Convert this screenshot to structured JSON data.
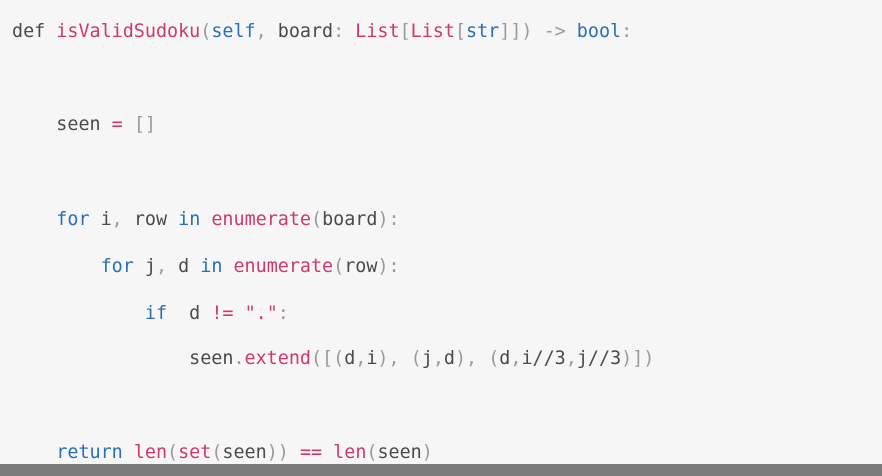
{
  "code": {
    "lines": [
      {
        "id": "line-def",
        "tokens": [
          {
            "t": "def",
            "c": "plain"
          },
          {
            "t": " ",
            "c": "plain"
          },
          {
            "t": "isValidSudoku",
            "c": "fn"
          },
          {
            "t": "(",
            "c": "punc"
          },
          {
            "t": "self",
            "c": "kw"
          },
          {
            "t": ",",
            "c": "punc"
          },
          {
            "t": " board",
            "c": "plain"
          },
          {
            "t": ":",
            "c": "punc"
          },
          {
            "t": " ",
            "c": "plain"
          },
          {
            "t": "List",
            "c": "fn"
          },
          {
            "t": "[",
            "c": "punc"
          },
          {
            "t": "List",
            "c": "fn"
          },
          {
            "t": "[",
            "c": "punc"
          },
          {
            "t": "str",
            "c": "kw"
          },
          {
            "t": "]]",
            "c": "punc"
          },
          {
            "t": ")",
            "c": "punc"
          },
          {
            "t": " ",
            "c": "plain"
          },
          {
            "t": "->",
            "c": "punc"
          },
          {
            "t": " ",
            "c": "plain"
          },
          {
            "t": "bool",
            "c": "kw"
          },
          {
            "t": ":",
            "c": "punc"
          }
        ]
      },
      {
        "id": "line-seen",
        "tokens": [
          {
            "t": "    ",
            "c": "plain"
          },
          {
            "t": "seen",
            "c": "plain"
          },
          {
            "t": " ",
            "c": "plain"
          },
          {
            "t": "=",
            "c": "op"
          },
          {
            "t": " ",
            "c": "plain"
          },
          {
            "t": "[]",
            "c": "punc"
          }
        ]
      },
      {
        "id": "line-for-i",
        "tokens": [
          {
            "t": "    ",
            "c": "plain"
          },
          {
            "t": "for",
            "c": "kw"
          },
          {
            "t": " i",
            "c": "plain"
          },
          {
            "t": ",",
            "c": "punc"
          },
          {
            "t": " row ",
            "c": "plain"
          },
          {
            "t": "in",
            "c": "kw"
          },
          {
            "t": " ",
            "c": "plain"
          },
          {
            "t": "enumerate",
            "c": "fn"
          },
          {
            "t": "(",
            "c": "punc"
          },
          {
            "t": "board",
            "c": "plain"
          },
          {
            "t": "):",
            "c": "punc"
          }
        ]
      },
      {
        "id": "line-for-j",
        "tokens": [
          {
            "t": "        ",
            "c": "plain"
          },
          {
            "t": "for",
            "c": "kw"
          },
          {
            "t": " j",
            "c": "plain"
          },
          {
            "t": ",",
            "c": "punc"
          },
          {
            "t": " d ",
            "c": "plain"
          },
          {
            "t": "in",
            "c": "kw"
          },
          {
            "t": " ",
            "c": "plain"
          },
          {
            "t": "enumerate",
            "c": "fn"
          },
          {
            "t": "(",
            "c": "punc"
          },
          {
            "t": "row",
            "c": "plain"
          },
          {
            "t": "):",
            "c": "punc"
          }
        ]
      },
      {
        "id": "line-if",
        "tokens": [
          {
            "t": "            ",
            "c": "plain"
          },
          {
            "t": "if",
            "c": "kw"
          },
          {
            "t": "  d ",
            "c": "plain"
          },
          {
            "t": "!=",
            "c": "op"
          },
          {
            "t": " ",
            "c": "plain"
          },
          {
            "t": "\".\"",
            "c": "str"
          },
          {
            "t": ":",
            "c": "punc"
          }
        ]
      },
      {
        "id": "line-extend",
        "tokens": [
          {
            "t": "                ",
            "c": "plain"
          },
          {
            "t": "seen",
            "c": "plain"
          },
          {
            "t": ".",
            "c": "punc"
          },
          {
            "t": "extend",
            "c": "fn"
          },
          {
            "t": "([(",
            "c": "punc"
          },
          {
            "t": "d",
            "c": "plain"
          },
          {
            "t": ",",
            "c": "punc"
          },
          {
            "t": "i",
            "c": "plain"
          },
          {
            "t": "),",
            "c": "punc"
          },
          {
            "t": " ",
            "c": "plain"
          },
          {
            "t": "(",
            "c": "punc"
          },
          {
            "t": "j",
            "c": "plain"
          },
          {
            "t": ",",
            "c": "punc"
          },
          {
            "t": "d",
            "c": "plain"
          },
          {
            "t": "),",
            "c": "punc"
          },
          {
            "t": " ",
            "c": "plain"
          },
          {
            "t": "(",
            "c": "punc"
          },
          {
            "t": "d",
            "c": "plain"
          },
          {
            "t": ",",
            "c": "punc"
          },
          {
            "t": "i",
            "c": "plain"
          },
          {
            "t": "//",
            "c": "plain"
          },
          {
            "t": "3",
            "c": "plain"
          },
          {
            "t": ",",
            "c": "punc"
          },
          {
            "t": "j",
            "c": "plain"
          },
          {
            "t": "//",
            "c": "plain"
          },
          {
            "t": "3",
            "c": "plain"
          },
          {
            "t": ")])",
            "c": "punc"
          }
        ]
      },
      {
        "id": "line-return",
        "tokens": [
          {
            "t": "    ",
            "c": "plain"
          },
          {
            "t": "return",
            "c": "kw"
          },
          {
            "t": " ",
            "c": "plain"
          },
          {
            "t": "len",
            "c": "fn"
          },
          {
            "t": "(",
            "c": "punc"
          },
          {
            "t": "set",
            "c": "fn"
          },
          {
            "t": "(",
            "c": "punc"
          },
          {
            "t": "seen",
            "c": "plain"
          },
          {
            "t": "))",
            "c": "punc"
          },
          {
            "t": " ",
            "c": "plain"
          },
          {
            "t": "==",
            "c": "op"
          },
          {
            "t": " ",
            "c": "plain"
          },
          {
            "t": "len",
            "c": "fn"
          },
          {
            "t": "(",
            "c": "punc"
          },
          {
            "t": "seen",
            "c": "plain"
          },
          {
            "t": ")",
            "c": "punc"
          }
        ]
      }
    ]
  },
  "colors": {
    "keyword": "#2a6fb5",
    "function": "#d0386a",
    "punctuation": "#9a9a9a",
    "text": "#4a4a4a",
    "background": "#f6f6f6"
  }
}
